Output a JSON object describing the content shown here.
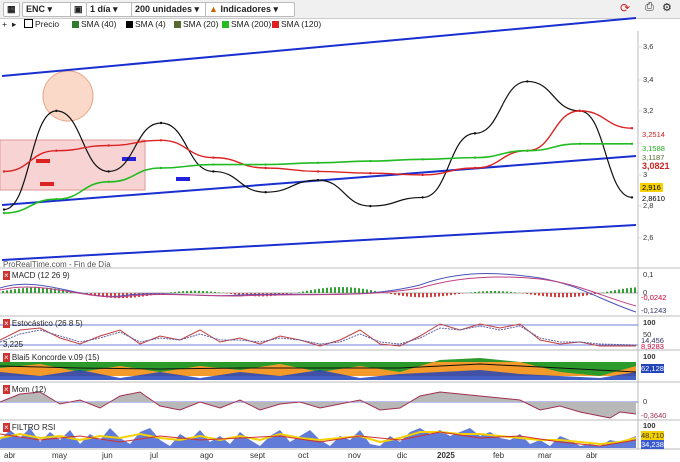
{
  "toolbar": {
    "symbol": "ENC",
    "timeframe": "1 día",
    "units": "200 unidades",
    "indicators": "Indicadores"
  },
  "legend": {
    "items": [
      {
        "label": "Precio",
        "color": "#000000"
      },
      {
        "label": "SMA (40)",
        "color": "#2e7d2e"
      },
      {
        "label": "SMA (4)",
        "color": "#000000"
      },
      {
        "label": "SMA (20)",
        "color": "#556b2f"
      },
      {
        "label": "SMA (200)",
        "color": "#22bb22"
      },
      {
        "label": "SMA (120)",
        "color": "#dd2222"
      }
    ]
  },
  "source_note": "ProRealTime.com - Fin de Día",
  "panels": {
    "macd": {
      "title": "MACD (12 26 9)",
      "ticks": [
        "0,1",
        "0"
      ],
      "values": [
        "-0,0242",
        "-0,1243"
      ]
    },
    "stoch": {
      "title": "Estocástico (26 8 5)",
      "ticks": [
        "100",
        "50"
      ],
      "values": [
        "14,456",
        "8,9283"
      ]
    },
    "blai": {
      "title": "Blai5 Koncorde v.09 (15)",
      "ticks": [
        "100"
      ],
      "values": [
        "62,128",
        "3,225"
      ],
      "left_value": "3,225"
    },
    "mom": {
      "title": "Mom (12)",
      "ticks": [
        "0"
      ],
      "values": [
        "-0,3640"
      ]
    },
    "rsi": {
      "title": "FILTRO RSI",
      "ticks": [
        "100"
      ],
      "values": [
        "48,710",
        "34,238"
      ]
    }
  },
  "price_ticks": [
    "3,6",
    "3,4",
    "3,2",
    "3",
    "2,8",
    "2,6"
  ],
  "price_labels": [
    {
      "text": "3,2514",
      "color": "#cc2222"
    },
    {
      "text": "3,1588",
      "color": "#22aa22"
    },
    {
      "text": "3,1187",
      "color": "#556b2f"
    },
    {
      "text": "3,0821",
      "color": "#cc2222"
    },
    {
      "text": "2,916",
      "color": "#000000"
    },
    {
      "text": "2,8610",
      "color": "#000000"
    }
  ],
  "months": [
    "abr",
    "may",
    "jun",
    "jul",
    "ago",
    "sept",
    "oct",
    "nov",
    "dic",
    "2025",
    "feb",
    "mar",
    "abr"
  ],
  "chart_data": {
    "type": "line",
    "title": "ENC",
    "x": [
      "abr",
      "may",
      "jun",
      "jul",
      "ago",
      "sept",
      "oct",
      "nov",
      "dic",
      "2025",
      "feb",
      "mar",
      "abr"
    ],
    "series": [
      {
        "name": "Precio",
        "values": [
          2.78,
          3.35,
          3.0,
          3.28,
          3.0,
          2.88,
          2.95,
          2.8,
          2.85,
          3.22,
          3.52,
          3.35,
          2.85
        ]
      },
      {
        "name": "SMA (120)",
        "values": [
          3.0,
          3.12,
          3.15,
          3.18,
          3.08,
          3.02,
          3.0,
          2.99,
          2.98,
          3.02,
          3.12,
          3.35,
          3.25
        ]
      },
      {
        "name": "SMA (200)",
        "values": [
          2.76,
          2.84,
          2.94,
          3.02,
          3.04,
          3.04,
          3.05,
          3.06,
          3.07,
          3.08,
          3.12,
          3.16,
          3.16
        ]
      }
    ],
    "ylim": [
      2.5,
      3.8
    ]
  }
}
